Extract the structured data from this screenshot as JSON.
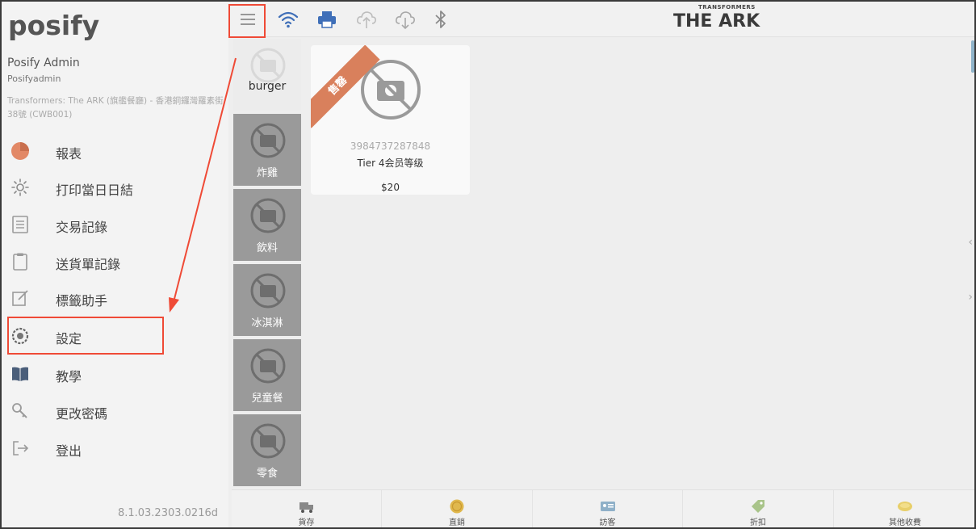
{
  "drawer": {
    "logo": "posify",
    "user_name": "Posify Admin",
    "user_handle": "Posifyadmin",
    "store_name": "Transformers: The ARK (旗艦餐廳) - 香港銅鑼灣羅素街38號 (CWB001)",
    "items": [
      {
        "label": "報表",
        "icon": "pie-chart-icon"
      },
      {
        "label": "打印當日日結",
        "icon": "sun-icon"
      },
      {
        "label": "交易記錄",
        "icon": "list-document-icon"
      },
      {
        "label": "送貨單記錄",
        "icon": "clipboard-icon"
      },
      {
        "label": "標籤助手",
        "icon": "edit-note-icon"
      },
      {
        "label": "設定",
        "icon": "settings-icon"
      },
      {
        "label": "教學",
        "icon": "book-icon"
      },
      {
        "label": "更改密碼",
        "icon": "key-icon"
      },
      {
        "label": "登出",
        "icon": "logout-icon"
      }
    ],
    "version": "8.1.03.2303.0216d"
  },
  "topbar": {
    "icons": [
      "menu-icon",
      "wifi-icon",
      "printer-icon",
      "cloud-upload-icon",
      "cloud-download-icon",
      "bluetooth-icon"
    ],
    "brand_small": "TRANSFORMERS",
    "brand_big": "THE ARK"
  },
  "categories": [
    {
      "label": "burger",
      "active": true
    },
    {
      "label": "炸雞",
      "active": false
    },
    {
      "label": "飲料",
      "active": false
    },
    {
      "label": "冰淇淋",
      "active": false
    },
    {
      "label": "兒童餐",
      "active": false
    },
    {
      "label": "零食",
      "active": false
    }
  ],
  "product": {
    "ribbon": "售罄",
    "sku": "3984737287848",
    "name": "Tier 4会员等级",
    "price": "$20"
  },
  "bottombar": [
    {
      "label": "貨存",
      "icon": "truck-icon"
    },
    {
      "label": "直銷",
      "icon": "coin-icon"
    },
    {
      "label": "訪客",
      "icon": "visitor-card-icon"
    },
    {
      "label": "折扣",
      "icon": "discount-tag-icon"
    },
    {
      "label": "其他收費",
      "icon": "extra-charge-icon"
    }
  ],
  "colors": {
    "annotation": "#ef4a36",
    "ribbon": "#d9805c",
    "icon_blue": "#3f6fb8"
  }
}
